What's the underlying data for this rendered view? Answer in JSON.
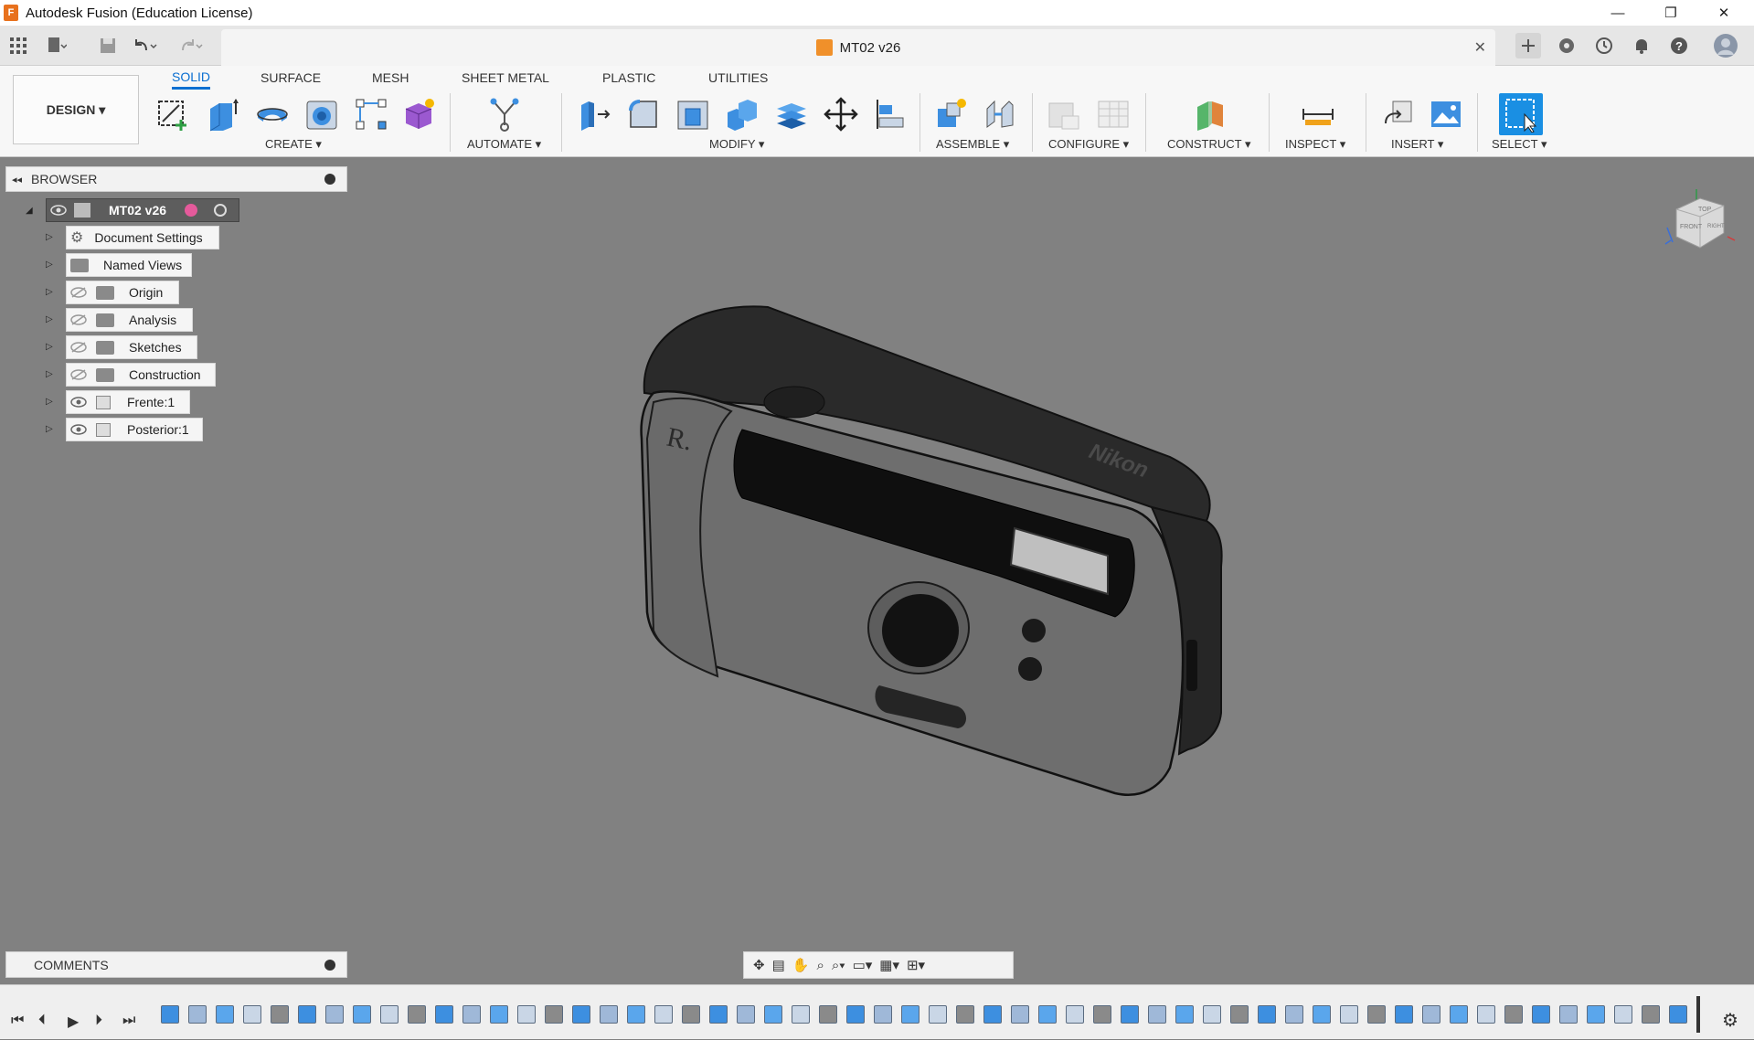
{
  "titlebar": {
    "title": "Autodesk Fusion (Education License)",
    "app_icon": "F",
    "minimize_icon": "—",
    "restore_icon": "❐",
    "close_icon": "✕"
  },
  "tabbar": {
    "document_tab": "MT02 v26",
    "close_icon": "✕"
  },
  "ribbon": {
    "workspace": "DESIGN ▾",
    "tabs": [
      "SOLID",
      "SURFACE",
      "MESH",
      "SHEET METAL",
      "PLASTIC",
      "UTILITIES"
    ],
    "active_tab": "SOLID",
    "groups": [
      "CREATE ▾",
      "AUTOMATE ▾",
      "MODIFY ▾",
      "ASSEMBLE ▾",
      "CONFIGURE ▾",
      "CONSTRUCT ▾",
      "INSPECT ▾",
      "INSERT ▾",
      "SELECT ▾"
    ],
    "accent_color": "#0a6fd1"
  },
  "browser": {
    "title": "BROWSER",
    "root": "MT02 v26",
    "items": [
      "Document Settings",
      "Named Views",
      "Origin",
      "Analysis",
      "Sketches",
      "Construction",
      "Frente:1",
      "Posterior:1"
    ]
  },
  "comments": {
    "title": "COMMENTS"
  },
  "model": {
    "brand_text": "Nikon"
  },
  "viewcube": {
    "top": "TOP",
    "front": "FRONT",
    "right": "RIGHT"
  }
}
